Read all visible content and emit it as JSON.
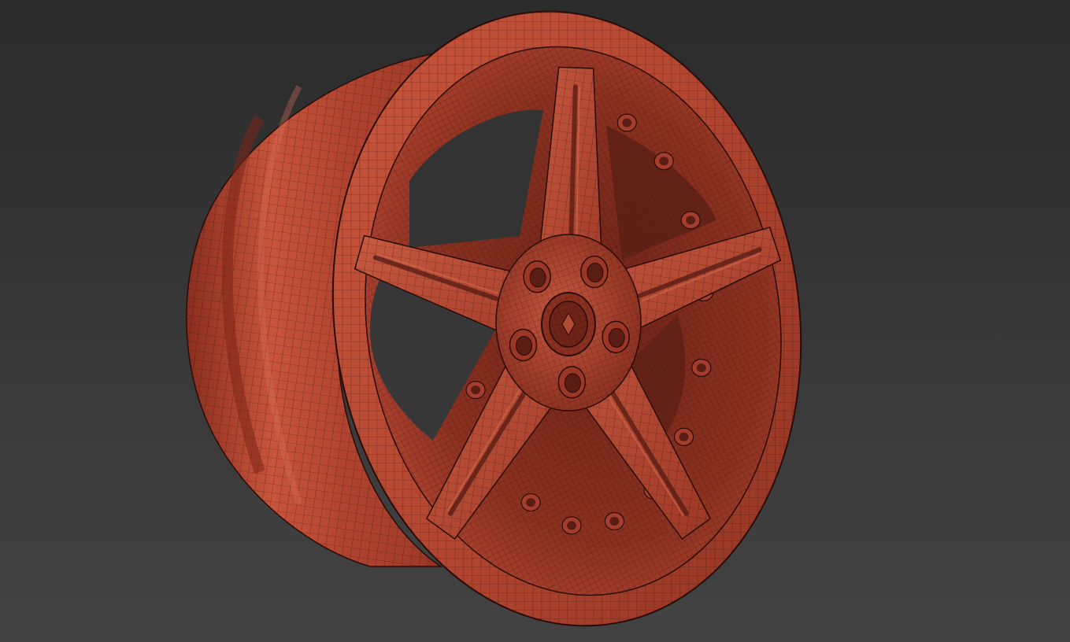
{
  "viewport": {
    "background_top": "#2b2b2b",
    "background_bottom": "#434343"
  },
  "model": {
    "subject": "wheel-rim",
    "render_mode": "wireframe-on-shaded",
    "base_color": "#b5452f",
    "highlight_color": "#d66a52",
    "shadow_color": "#5a1d14",
    "wire_color": "#2a0c07",
    "spoke_count": 5,
    "lug_hole_count": 5,
    "rim_bolt_count": 12
  }
}
